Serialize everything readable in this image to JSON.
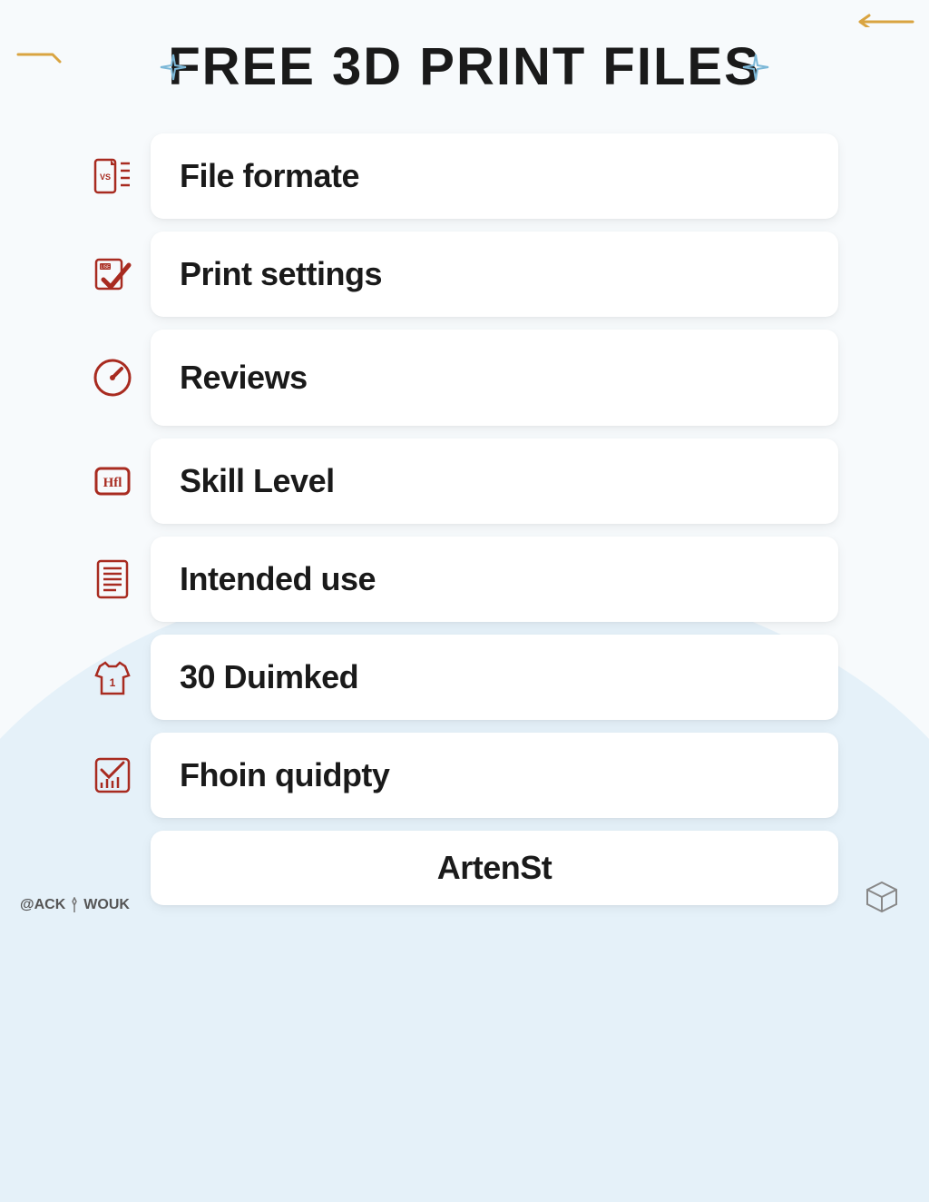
{
  "title": "FREE 3D PRINT FILES",
  "items": [
    {
      "label": "File formate"
    },
    {
      "label": "Print settings"
    },
    {
      "label": "Reviews"
    },
    {
      "label": "Skill Level"
    },
    {
      "label": "Intended use"
    },
    {
      "label": "30 Duimked"
    },
    {
      "label": "Fhoin quidpty"
    }
  ],
  "footer_card": "ArtenSt",
  "handle": {
    "prefix": "@ACK",
    "suffix": "WOUK"
  },
  "colors": {
    "icon": "#a82b20",
    "accent": "#d9a441"
  }
}
